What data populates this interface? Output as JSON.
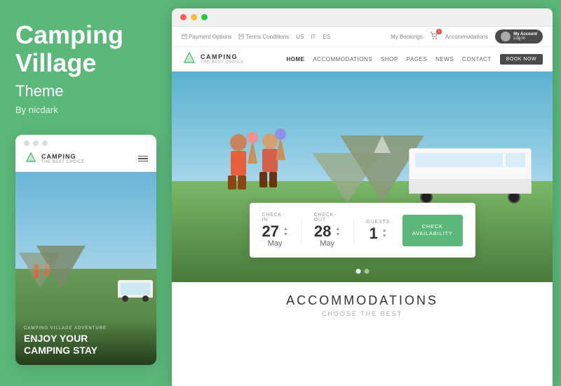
{
  "left": {
    "title_line1": "Camping",
    "title_line2": "Village",
    "subtitle": "Theme",
    "by": "By nicdark",
    "mobile": {
      "logo_name": "CAMPING",
      "logo_tagline": "THE BEST CHOICE",
      "adventure_text": "CAMPING VILLAGE ADVENTURE",
      "hero_title_line1": "ENJOY YOUR",
      "hero_title_line2": "CAMPING STAY"
    }
  },
  "browser": {
    "topbar": {
      "payment_options": "Payment Options",
      "terms_conditions": "Terms Conditions",
      "lang_us": "US",
      "lang_it": "IT",
      "lang_es": "ES",
      "my_bookings": "My Bookings",
      "accommodations": "Accommodations",
      "my_account": "My Account",
      "log_in": "Log In"
    },
    "navbar": {
      "logo_name": "CAMPING",
      "logo_tagline": "THE BEST CHOICE",
      "nav_items": [
        "HOME",
        "ACCOMMODATIONS",
        "SHOP",
        "PAGES",
        "NEWS",
        "CONTACT"
      ],
      "book_now": "BOOK NOW"
    },
    "booking": {
      "checkin_label": "CHECK-IN",
      "checkin_day": "27",
      "checkin_month": "May",
      "checkout_label": "CHECK-OUT",
      "checkout_day": "28",
      "checkout_month": "May",
      "guests_label": "GUESTS",
      "guests_value": "1",
      "check_avail_line1": "CHECK",
      "check_avail_line2": "AVAILABILITY"
    },
    "accommodations": {
      "title": "ACCOMMODATIONS",
      "subtitle": "CHOOSE THE BEST"
    }
  }
}
